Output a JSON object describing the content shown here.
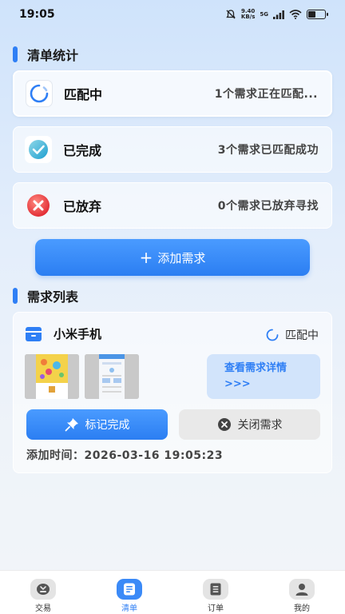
{
  "status_bar": {
    "time": "19:05",
    "net_speed": "9.40",
    "net_unit": "KB/s",
    "signal": "5G"
  },
  "summary": {
    "title": "清单统计",
    "items": [
      {
        "name": "匹配中",
        "desc": "1个需求正在匹配..."
      },
      {
        "name": "已完成",
        "desc": "3个需求已匹配成功"
      },
      {
        "name": "已放弃",
        "desc": "0个需求已放弃寻找"
      }
    ]
  },
  "add_button": {
    "label": "添加需求"
  },
  "list": {
    "title": "需求列表",
    "items": [
      {
        "name": "小米手机",
        "status": "匹配中",
        "detail_line1": "查看需求详情",
        "detail_line2": ">>>",
        "mark_label": "标记完成",
        "close_label": "关闭需求",
        "added_time": "添加时间：2026-03-16 19:05:23"
      }
    ]
  },
  "tabs": [
    {
      "label": "交易",
      "icon": "trade-icon"
    },
    {
      "label": "清单",
      "icon": "list-icon",
      "active": true
    },
    {
      "label": "订单",
      "icon": "order-icon"
    },
    {
      "label": "我的",
      "icon": "profile-icon"
    }
  ],
  "colors": {
    "accent": "#2f7ff5",
    "completed": "#29b8d6",
    "abandoned": "#f0454a"
  }
}
